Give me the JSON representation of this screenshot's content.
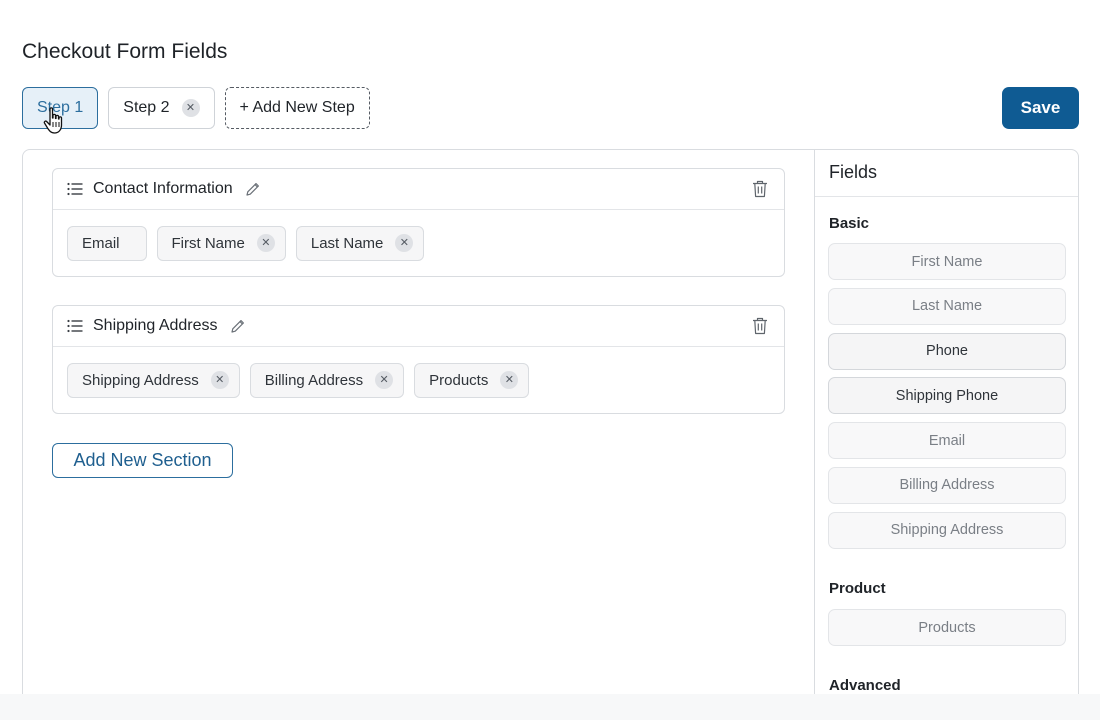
{
  "page": {
    "title": "Checkout Form Fields"
  },
  "steps": [
    {
      "label": "Step 1",
      "active": true,
      "removable": false
    },
    {
      "label": "Step 2",
      "active": false,
      "removable": true
    }
  ],
  "add_step_label": "+ Add New Step",
  "save_label": "Save",
  "sections": [
    {
      "title": "Contact Information",
      "fields": [
        {
          "label": "Email",
          "removable": false
        },
        {
          "label": "First Name",
          "removable": true
        },
        {
          "label": "Last Name",
          "removable": true
        }
      ]
    },
    {
      "title": "Shipping Address",
      "fields": [
        {
          "label": "Shipping Address",
          "removable": true
        },
        {
          "label": "Billing Address",
          "removable": true
        },
        {
          "label": "Products",
          "removable": true
        }
      ]
    }
  ],
  "add_section_label": "Add New Section",
  "sidebar": {
    "title": "Fields",
    "groups": [
      {
        "label": "Basic",
        "items": [
          {
            "label": "First Name",
            "enabled": false
          },
          {
            "label": "Last Name",
            "enabled": false
          },
          {
            "label": "Phone",
            "enabled": true
          },
          {
            "label": "Shipping Phone",
            "enabled": true
          },
          {
            "label": "Email",
            "enabled": false
          },
          {
            "label": "Billing Address",
            "enabled": false
          },
          {
            "label": "Shipping Address",
            "enabled": false
          }
        ]
      },
      {
        "label": "Product",
        "items": [
          {
            "label": "Products",
            "enabled": false
          }
        ]
      },
      {
        "label": "Advanced",
        "items": []
      }
    ]
  },
  "colors": {
    "accent": "#0f5b93",
    "active_tab_bg": "#e6f0f8",
    "active_tab_border": "#2c6e9e"
  }
}
